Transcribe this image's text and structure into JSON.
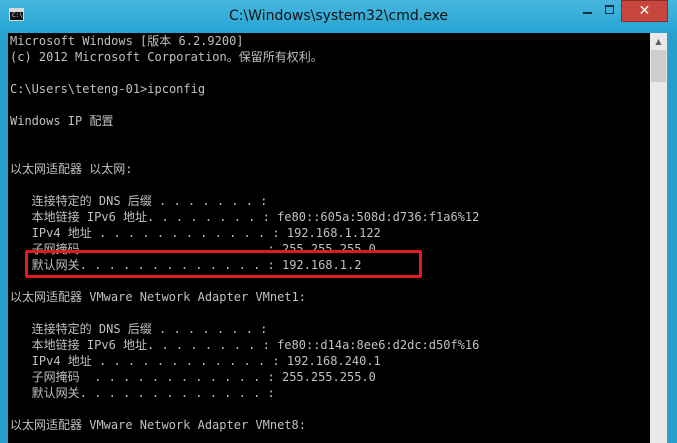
{
  "window": {
    "title": "C:\\Windows\\system32\\cmd.exe",
    "icon_text": "C:\\",
    "close_glyph": "✕",
    "scroll_up_glyph": "▲"
  },
  "console": {
    "lines": [
      "Microsoft Windows [版本 6.2.9200]",
      "(c) 2012 Microsoft Corporation。保留所有权利。",
      "",
      "C:\\Users\\teteng-01>ipconfig",
      "",
      "Windows IP 配置",
      "",
      "",
      "以太网适配器 以太网:",
      "",
      "   连接特定的 DNS 后缀 . . . . . . . :",
      "   本地链接 IPv6 地址. . . . . . . . : fe80::605a:508d:d736:f1a6%12",
      "   IPv4 地址 . . . . . . . . . . . . : 192.168.1.122",
      "   子网掩码  . . . . . . . . . . . . : 255.255.255.0",
      "   默认网关. . . . . . . . . . . . . : 192.168.1.2",
      "",
      "以太网适配器 VMware Network Adapter VMnet1:",
      "",
      "   连接特定的 DNS 后缀 . . . . . . . :",
      "   本地链接 IPv6 地址. . . . . . . . : fe80::d14a:8ee6:d2dc:d50f%16",
      "   IPv4 地址 . . . . . . . . . . . . : 192.168.240.1",
      "   子网掩码  . . . . . . . . . . . . : 255.255.255.0",
      "   默认网关. . . . . . . . . . . . . :",
      "",
      "以太网适配器 VMware Network Adapter VMnet8:"
    ]
  },
  "colors": {
    "highlight": "#e01b1b",
    "console_bg": "#000000",
    "console_text": "#c0c0c0",
    "titlebar": "#27a4d2"
  }
}
